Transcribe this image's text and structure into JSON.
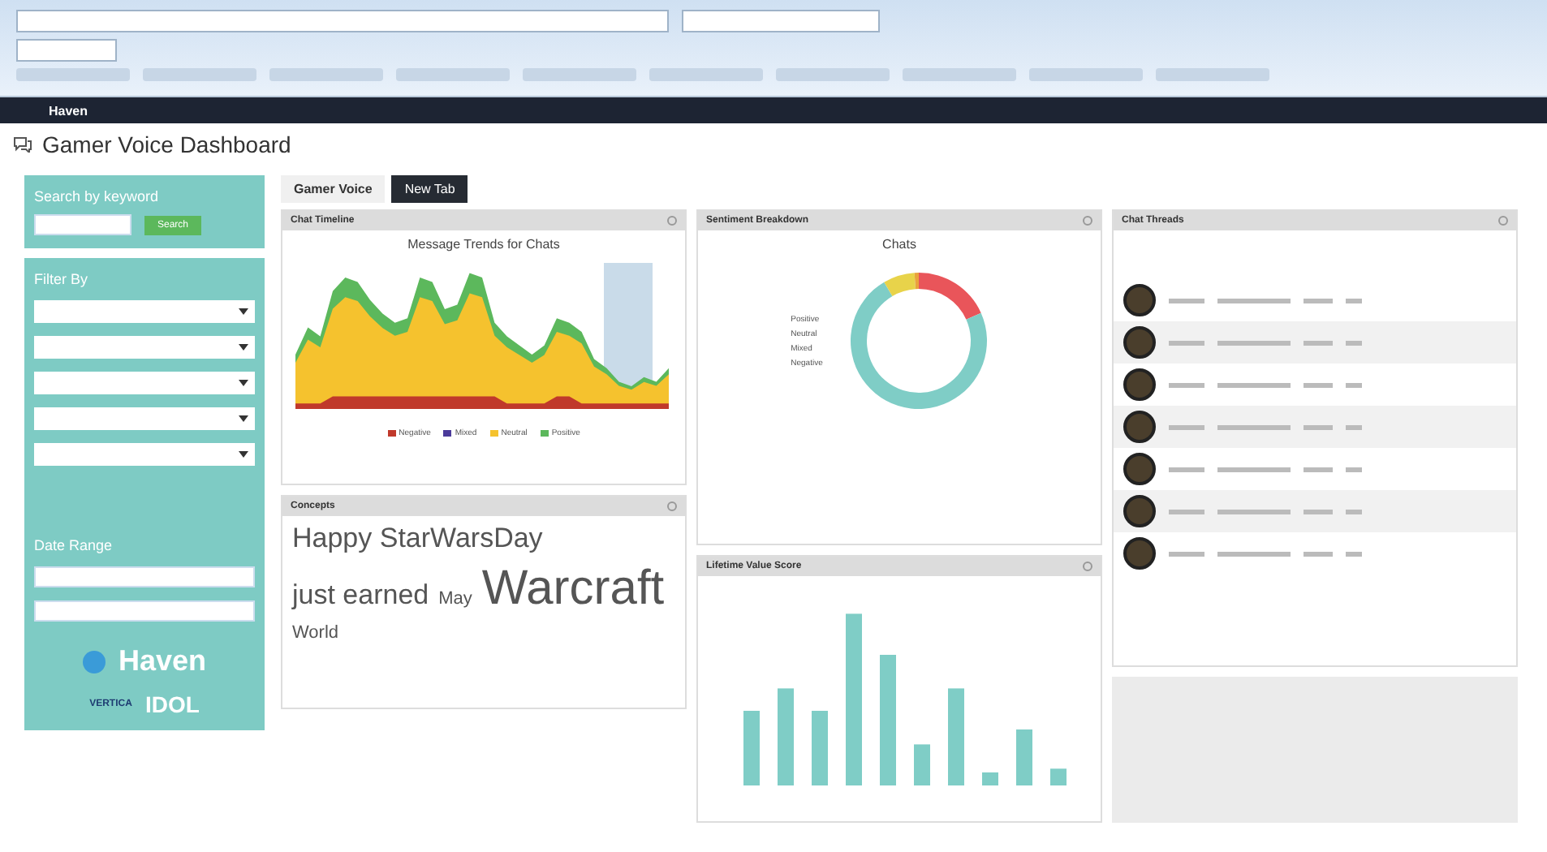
{
  "app_bar": {
    "brand": "Haven"
  },
  "page": {
    "title": "Gamer Voice Dashboard"
  },
  "sidebar": {
    "search": {
      "label": "Search by keyword",
      "button": "Search"
    },
    "filter": {
      "label": "Filter By",
      "selects": [
        {
          "kind": "select"
        },
        {
          "kind": "select"
        },
        {
          "kind": "select"
        },
        {
          "kind": "select"
        },
        {
          "kind": "select"
        }
      ]
    },
    "date_range": {
      "label": "Date Range"
    },
    "logos": {
      "haven": "Haven",
      "idol": "IDOL",
      "vertica": "VERTICA"
    }
  },
  "tabs": [
    {
      "label": "Gamer Voice",
      "selected": true
    },
    {
      "label": "New Tab",
      "selected": false
    }
  ],
  "panels": {
    "timeline": {
      "title": "Chat Timeline",
      "chart_title": "Message Trends for Chats",
      "legend": [
        {
          "label": "Negative",
          "color": "#c0392b"
        },
        {
          "label": "Mixed",
          "color": "#4b3b9b"
        },
        {
          "label": "Neutral",
          "color": "#f5c22e"
        },
        {
          "label": "Positive",
          "color": "#5cb85c"
        }
      ]
    },
    "concepts": {
      "title": "Concepts",
      "words": [
        {
          "text": "Happy StarWarsDay",
          "kind": "large"
        },
        {
          "text": "just earned",
          "kind": "large"
        },
        {
          "text": "May",
          "kind": "medium"
        },
        {
          "text": "Warcraft",
          "kind": "huge"
        },
        {
          "text": "World",
          "kind": "medium"
        }
      ]
    },
    "sentiment": {
      "title": "Sentiment Breakdown",
      "chart_title": "Chats",
      "slices": [
        {
          "label": "Positive",
          "color": "#e9555a"
        },
        {
          "label": "Neutral",
          "color": "#7fcdc6"
        },
        {
          "label": "Mixed",
          "color": "#e8d34a"
        },
        {
          "label": "Negative",
          "color": "#e9a33c"
        }
      ]
    },
    "lifetime": {
      "title": "Lifetime Value Score"
    },
    "threads": {
      "title": "Chat Threads",
      "rows": [
        {
          "kind": "tweet"
        },
        {
          "kind": "tweet"
        },
        {
          "kind": "tweet"
        },
        {
          "kind": "tweet"
        },
        {
          "kind": "tweet"
        },
        {
          "kind": "tweet"
        },
        {
          "kind": "tweet"
        }
      ]
    }
  }
}
